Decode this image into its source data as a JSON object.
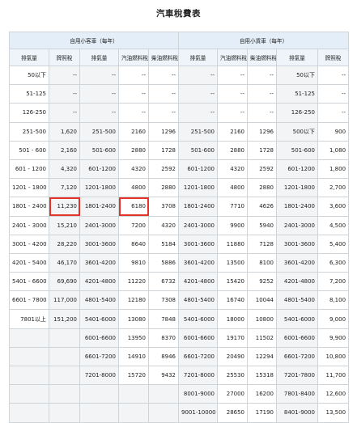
{
  "title": "汽車稅費表",
  "group_headers": [
    "自用小客車（每年）",
    "自用小貨車（每年）"
  ],
  "column_headers": [
    "排氣量",
    "牌照稅",
    "排氣量",
    "汽油燃料稅",
    "柴油燃料稅",
    "排氣量",
    "汽油燃料稅",
    "柴油燃料稅",
    "排氣量",
    "牌照稅"
  ],
  "rows": [
    [
      "50以下",
      "--",
      "--",
      "--",
      "--",
      "--",
      "--",
      "--",
      "50以下",
      "--"
    ],
    [
      "51-125",
      "--",
      "--",
      "--",
      "--",
      "--",
      "--",
      "--",
      "51-125",
      "--"
    ],
    [
      "126-250",
      "--",
      "--",
      "--",
      "--",
      "--",
      "--",
      "--",
      "126-250",
      "--"
    ],
    [
      "251-500",
      "1,620",
      "251-500",
      "2160",
      "1296",
      "251-500",
      "2160",
      "1296",
      "500以下",
      "900"
    ],
    [
      "501 - 600",
      "2,160",
      "501-600",
      "2880",
      "1728",
      "501-600",
      "2880",
      "1728",
      "501-600",
      "1,080"
    ],
    [
      "601 - 1200",
      "4,320",
      "601-1200",
      "4320",
      "2592",
      "601-1200",
      "4320",
      "2592",
      "601-1200",
      "1,800"
    ],
    [
      "1201 - 1800",
      "7,120",
      "1201-1800",
      "4800",
      "2880",
      "1201-1800",
      "4800",
      "2880",
      "1201-1800",
      "2,700"
    ],
    [
      "1801 - 2400",
      "11,230",
      "1801-2400",
      "6180",
      "3708",
      "1801-2400",
      "7710",
      "4626",
      "1801-2400",
      "3,600"
    ],
    [
      "2401 - 3000",
      "15,210",
      "2401-3000",
      "7200",
      "4320",
      "2401-3000",
      "9900",
      "5940",
      "2401-3000",
      "4,500"
    ],
    [
      "3001 - 4200",
      "28,220",
      "3001-3600",
      "8640",
      "5184",
      "3001-3600",
      "11880",
      "7128",
      "3001-3600",
      "5,400"
    ],
    [
      "4201 - 5400",
      "46,170",
      "3601-4200",
      "9810",
      "5886",
      "3601-4200",
      "13500",
      "8100",
      "3601-4200",
      "6,300"
    ],
    [
      "5401 - 6600",
      "69,690",
      "4201-4800",
      "11220",
      "6732",
      "4201-4800",
      "15420",
      "9252",
      "4201-4800",
      "7,200"
    ],
    [
      "6601 - 7800",
      "117,000",
      "4801-5400",
      "12180",
      "7308",
      "4801-5400",
      "16740",
      "10044",
      "4801-5400",
      "8,100"
    ],
    [
      "7801以上",
      "151,200",
      "5401-6000",
      "13080",
      "7848",
      "5401-6000",
      "18000",
      "10800",
      "5401-6000",
      "9,000"
    ],
    [
      "",
      "",
      "6001-6600",
      "13950",
      "8370",
      "6001-6600",
      "19170",
      "11502",
      "6001-6600",
      "9,900"
    ],
    [
      "",
      "",
      "6601-7200",
      "14910",
      "8946",
      "6601-7200",
      "20490",
      "12294",
      "6601-7200",
      "10,800"
    ],
    [
      "",
      "",
      "7201-8000",
      "15720",
      "9432",
      "7201-8000",
      "25530",
      "15318",
      "7201-7800",
      "11,700"
    ],
    [
      "",
      "",
      "",
      "",
      "",
      "8001-9000",
      "27000",
      "16200",
      "7801-8400",
      "12,600"
    ],
    [
      "",
      "",
      "",
      "",
      "",
      "9001-10000",
      "28650",
      "17190",
      "8401-9000",
      "13,500"
    ]
  ],
  "highlight_color": "#e5332a"
}
